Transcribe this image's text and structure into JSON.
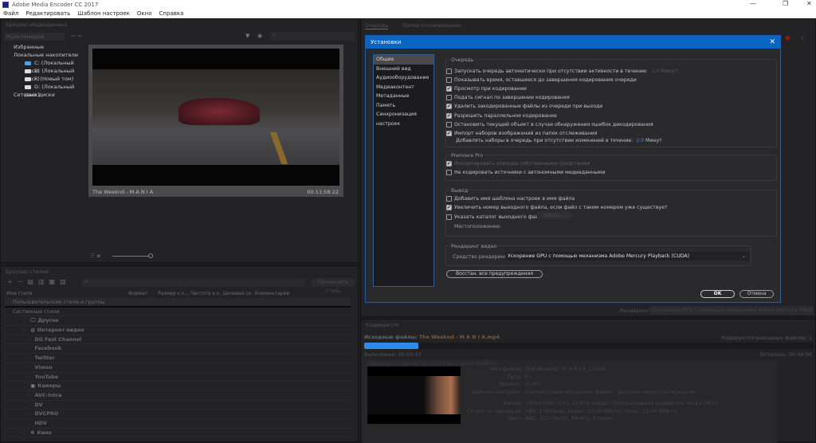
{
  "app": {
    "title": "Adobe Media Encoder CC 2017",
    "window_controls": [
      "—",
      "❐",
      "✕"
    ]
  },
  "menu": [
    "Файл",
    "Редактировать",
    "Шаблон настроек",
    "Окно",
    "Справка"
  ],
  "media_browser": {
    "title": "Браузер медиаданных",
    "dropdown": "Мультимедиа",
    "tree": {
      "favorites": "Избранные",
      "local": "Локальные накопители",
      "drives": [
        "C: (Локальный диск)",
        "D: (Локальный диск)",
        "F: (Новый том)",
        "G: (Локальный диск)"
      ],
      "network": "Сетевые диски"
    },
    "preview": {
      "name": "The Weeknd - M A N I A",
      "timecode": "00:11:58:22"
    }
  },
  "style_browser": {
    "title": "Браузер стилей",
    "apply_button": "Применить стиль",
    "columns": [
      "Имя стиля",
      "Формат",
      "Размер к.к...",
      "Частота к.к...",
      "Целевая ск...",
      "Комментарии"
    ],
    "user_group": "Пользовательские стили и группы",
    "system_group": "Системные стили",
    "items": [
      {
        "label": "Другое",
        "level": 1,
        "icon": "monitor-icon"
      },
      {
        "label": "Интернет-видео",
        "level": 1,
        "icon": "globe-icon"
      },
      {
        "label": "DG Fast Channel",
        "level": 2
      },
      {
        "label": "Facebook",
        "level": 2
      },
      {
        "label": "Twitter",
        "level": 2
      },
      {
        "label": "Vimeo",
        "level": 2
      },
      {
        "label": "YouTube",
        "level": 2
      },
      {
        "label": "Камеры",
        "level": 1,
        "icon": "camera-icon"
      },
      {
        "label": "AVC-Intra",
        "level": 2
      },
      {
        "label": "DV",
        "level": 2
      },
      {
        "label": "DVCPRO",
        "level": 2
      },
      {
        "label": "HDV",
        "level": 2
      },
      {
        "label": "Кино",
        "level": 1,
        "icon": "film-reel-icon"
      }
    ]
  },
  "queue": {
    "tabs": [
      "Очередь",
      "Папки отслеживания"
    ],
    "renderer_label": "Рендеринг:",
    "renderer_value": "Ускорение GPU с помощью механизма Adobe Mercury Playback (C..."
  },
  "dialog": {
    "title": "Установки",
    "nav": [
      "Общие",
      "Внешний вид",
      "Аудиооборудование",
      "Медиаконтент",
      "Метаданные",
      "Память",
      "Синхронизация настроек"
    ],
    "queue_group": {
      "title": "Очередь",
      "items": [
        {
          "label": "Запускать очередь автоматически при отсутствии активности в течение:",
          "checked": false,
          "suffix": "2,0 Минут"
        },
        {
          "label": "Показывать время, оставшееся до завершения кодирования очереди",
          "checked": false
        },
        {
          "label": "Просмотр при кодировании",
          "checked": true
        },
        {
          "label": "Подать сигнал по завершении кодирования",
          "checked": false
        },
        {
          "label": "Удалить закодированные файлы из очереди при выходе",
          "checked": true
        },
        {
          "label": "Разрешить параллельное кодирование",
          "checked": true
        },
        {
          "label": "Остановить текущий объект в случае обнаружения ошибок декодирования",
          "checked": false
        },
        {
          "label": "Импорт наборов изображений из папок отслеживания",
          "checked": true
        }
      ],
      "add_label": "Добавлять наборы в очередь при отсутствии изменений в течение:",
      "add_value": "2,0",
      "add_unit": "Минут"
    },
    "premiere_group": {
      "title": "Premiere Pro",
      "items": [
        {
          "label": "Импортировать эпизоды собственными средствами",
          "checked": true,
          "disabled": true
        },
        {
          "label": "Не кодировать источники с автономными медиаданными",
          "checked": false
        }
      ]
    },
    "output_group": {
      "title": "Вывод",
      "items": [
        {
          "label": "Добавить имя шаблона настроек в имя файла",
          "checked": false
        },
        {
          "label": "Увеличить номер выходного файла, если файл с таким номером уже существует",
          "checked": true
        },
        {
          "label": "Указать каталог выходного файла:",
          "checked": false
        }
      ],
      "browse": "Обзор...",
      "location_label": "Местоположение:"
    },
    "render_group": {
      "title": "Рендеринг видео",
      "label": "Средство рендеринга:",
      "value": "Ускорение GPU с помощью механизма Adobe Mercury Playback (CUDA)"
    },
    "reset_button": "Восстан. все предупреждения",
    "ok": "OK",
    "cancel": "Отмена"
  },
  "encoding": {
    "title": "Кодируется",
    "source_label": "Исходные файлы:",
    "source_file": "The Weeknd - M A N I A.mp4",
    "outputs": "Кодируется выходных файлов: 1",
    "progress": 0.12,
    "elapsed": "Выполнено: 00:00:53",
    "remaining": "Осталось: 00:06:56",
    "preview_label": "Предварительный просмотр выходных файлов",
    "info": [
      [
        "Имя файла:",
        "The Weeknd - M A N I A_1.mp4"
      ],
      [
        "Путь:",
        "F:\\"
      ],
      [
        "Формат:",
        "H.264"
      ],
      [
        "Шаблон настроек:",
        "Соответствие исходного файла – высокая скорость передачи"
      ],
      [
        "Видео:",
        "1920x1080 (1,0), 23,976 кадр/с, Прогрессивная развертка, 00:11:58:22"
      ],
      [
        "Скорость передачи:",
        "VBR, 1 проход, Задан. 10,00 Мбит/с, Макс. 12,00 Мбит/с"
      ],
      [
        "Звук:",
        "AAC, 320 кбит/с, 48 кГц, Стерео"
      ]
    ]
  },
  "colors": {
    "accent": "#0a64c2",
    "progress": "#2d8ceb"
  }
}
